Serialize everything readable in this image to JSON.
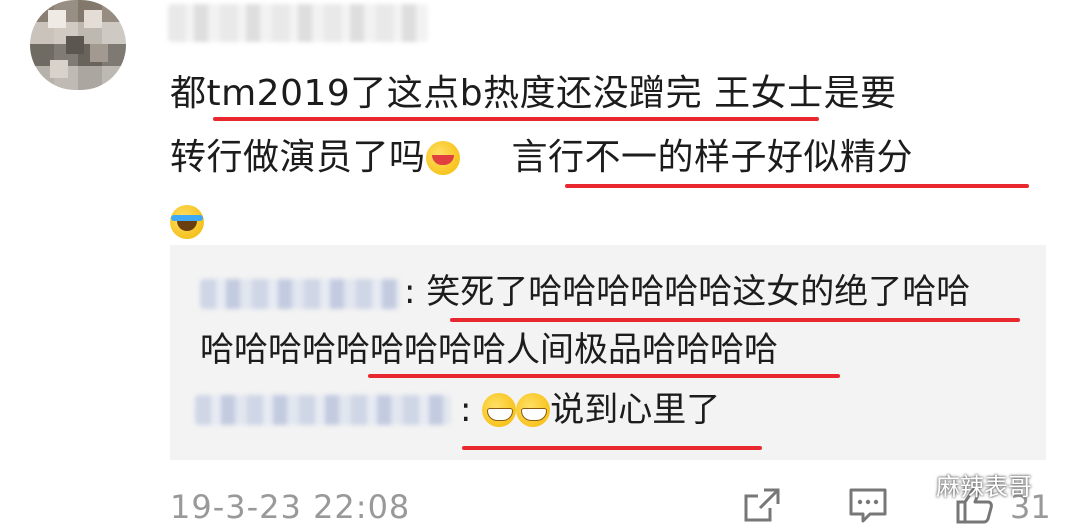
{
  "comment": {
    "lines": [
      "都tm2019了这点b热度还没蹭完  王女士是要",
      "转行做演员了吗",
      "言行不一的样子好似精分"
    ],
    "icons": [
      "face-love-icon",
      "face-laugh-cry-icon"
    ]
  },
  "replies": [
    {
      "text_line1": "笑死了哈哈哈哈哈哈这女的绝了哈哈",
      "text_line2": "哈哈哈哈哈哈哈哈哈人间极品哈哈哈哈",
      "sep": ":"
    },
    {
      "text": "说到心里了",
      "sep": ":",
      "icons": [
        "grin-icon",
        "grin-icon"
      ]
    }
  ],
  "footer": {
    "time": "19-3-23 22:08",
    "like_count": "31",
    "icons": [
      "share-icon",
      "comment-icon",
      "like-icon"
    ]
  },
  "watermark": {
    "text": "麻辣表哥",
    "icon": "wechat-icon"
  },
  "colors": {
    "underline": "#e8282e",
    "reply_bg": "#f3f3f3",
    "meta": "#999999"
  }
}
